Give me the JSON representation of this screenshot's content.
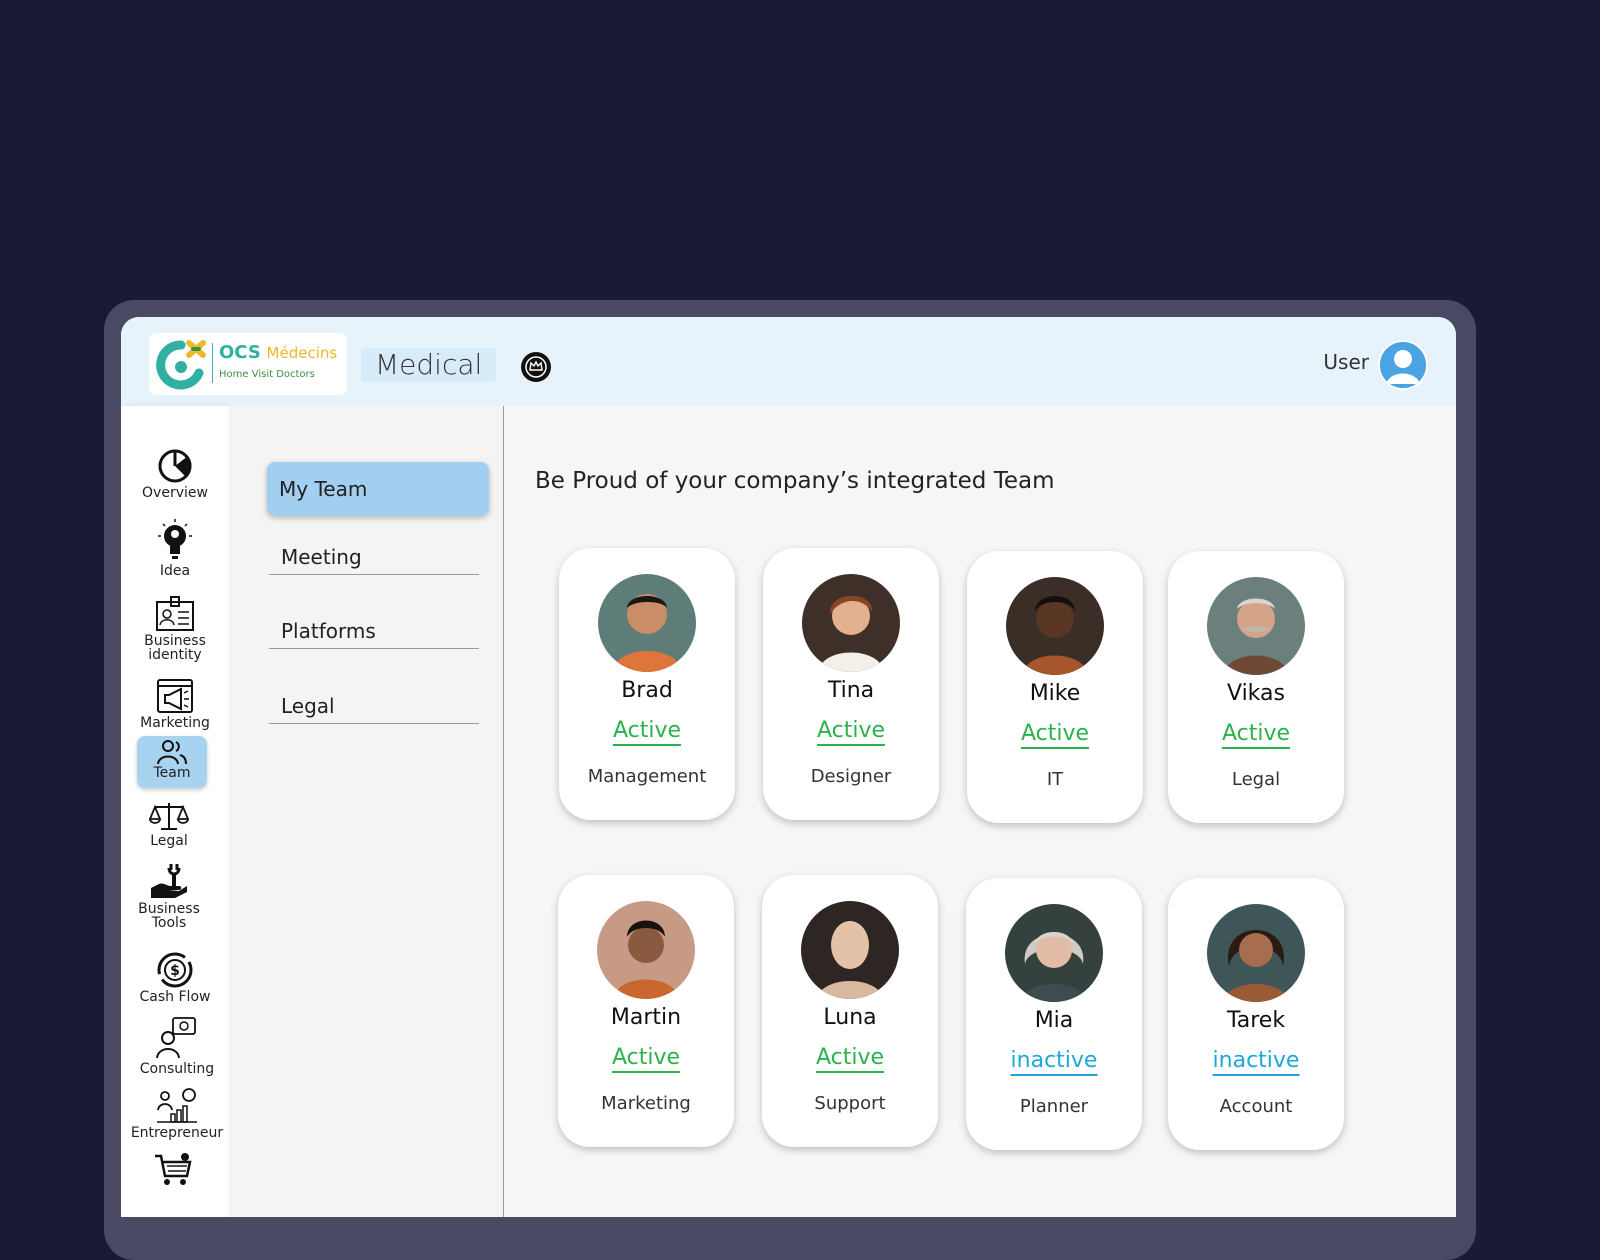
{
  "colors": {
    "background": "#1b1a36",
    "frame": "#4a4964",
    "topbar": "#e6f3fb",
    "accent_blue": "#a2cff0",
    "active_green": "#2bb24c",
    "inactive_blue": "#1ea7d8"
  },
  "header": {
    "logo": {
      "brand_main": "OCS",
      "brand_sub": "Médecins",
      "tagline": "Home Visit Doctors"
    },
    "workspace_label": "Medical",
    "badge_icon": "crown-badge-icon",
    "user_label": "User",
    "avatar_icon": "user-avatar-icon"
  },
  "sidebar": {
    "items": [
      {
        "label": "Overview",
        "icon": "pie-chart-icon",
        "active": false
      },
      {
        "label": "Idea",
        "icon": "lightbulb-icon",
        "active": false
      },
      {
        "label": "Business identity",
        "icon": "id-card-icon",
        "active": false
      },
      {
        "label": "Marketing",
        "icon": "megaphone-icon",
        "active": false
      },
      {
        "label": "Team",
        "icon": "people-icon",
        "active": true
      },
      {
        "label": "Legal",
        "icon": "scales-icon",
        "active": false
      },
      {
        "label": "Business Tools",
        "icon": "tools-hand-icon",
        "active": false
      },
      {
        "label": "Cash Flow",
        "icon": "dollar-cycle-icon",
        "active": false
      },
      {
        "label": "Consulting",
        "icon": "consulting-icon",
        "active": false
      },
      {
        "label": "Entrepreneur",
        "icon": "growth-idea-icon",
        "active": false
      },
      {
        "label": "",
        "icon": "shopping-cart-icon",
        "active": false
      }
    ]
  },
  "subnav": {
    "items": [
      {
        "label": "My Team",
        "active": true
      },
      {
        "label": "Meeting",
        "active": false
      },
      {
        "label": "Platforms",
        "active": false
      },
      {
        "label": "Legal",
        "active": false
      }
    ]
  },
  "main": {
    "headline": "Be Proud of your company’s integrated Team",
    "members": [
      {
        "name": "Brad",
        "status": "Active",
        "role": "Management"
      },
      {
        "name": "Tina",
        "status": "Active",
        "role": "Designer"
      },
      {
        "name": "Mike",
        "status": "Active",
        "role": "IT"
      },
      {
        "name": "Vikas",
        "status": "Active",
        "role": "Legal"
      },
      {
        "name": "Martin",
        "status": "Active",
        "role": "Marketing"
      },
      {
        "name": "Luna",
        "status": "Active",
        "role": "Support"
      },
      {
        "name": "Mia",
        "status": "inactive",
        "role": "Planner"
      },
      {
        "name": "Tarek",
        "status": "inactive",
        "role": "Account"
      }
    ]
  }
}
